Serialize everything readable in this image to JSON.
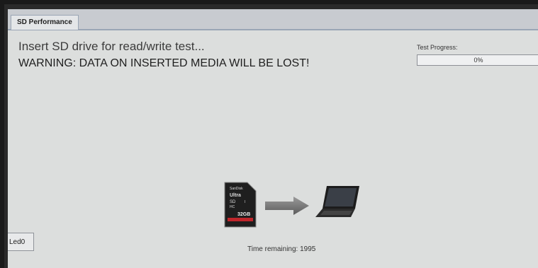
{
  "tabs": [
    {
      "label": "SD Performance"
    }
  ],
  "main": {
    "message": "Insert SD drive for read/write test...",
    "warning": "WARNING: DATA ON INSERTED MEDIA WILL BE LOST!",
    "time_remaining": "Time remaining: 1995"
  },
  "progress": {
    "label": "Test Progress:",
    "value_text": "0%",
    "value": 0
  },
  "side_button": {
    "label": "Led0"
  },
  "illustration": {
    "sd_card_text": [
      "SanDisk",
      "Ultra",
      "SD",
      "HC",
      "I",
      "32GB"
    ],
    "icons": [
      "sd-card-icon",
      "arrow-right-icon",
      "laptop-icon"
    ]
  },
  "colors": {
    "background": "#dcdedd",
    "tab_bar": "#c8cbd0",
    "progress_fill": "#5a8fd8"
  }
}
